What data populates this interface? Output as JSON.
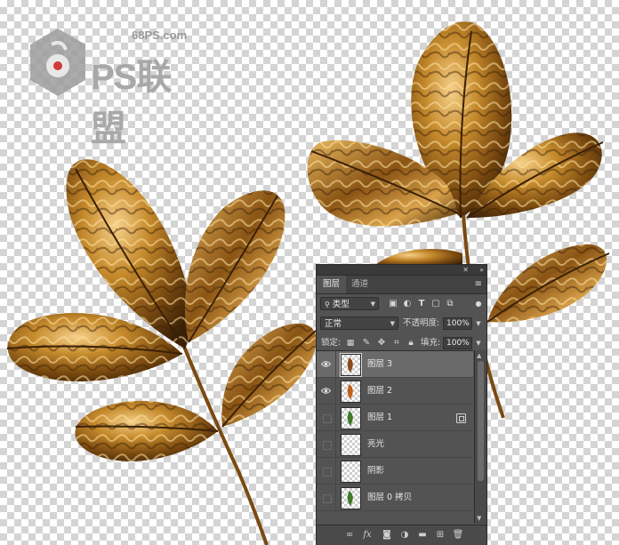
{
  "watermark": {
    "domain": "68PS.com",
    "title": "PS联盟"
  },
  "panel": {
    "tabs": [
      {
        "label": "图层",
        "active": true
      },
      {
        "label": "通道",
        "active": false
      }
    ],
    "filter": {
      "kind_label": "类型",
      "icons": [
        "image-filter-icon",
        "adjustment-filter-icon",
        "type-filter-icon",
        "shape-filter-icon",
        "smart-object-filter-icon"
      ]
    },
    "blend_mode": "正常",
    "opacity_label": "不透明度:",
    "opacity_value": "100%",
    "lock_label": "锁定:",
    "fill_label": "填充:",
    "fill_value": "100%",
    "layers": [
      {
        "name": "图层 3",
        "visible": true,
        "selected": true,
        "thumb": "leaf-brown"
      },
      {
        "name": "图层 2",
        "visible": true,
        "selected": false,
        "thumb": "leaf-orange"
      },
      {
        "name": "图层 1",
        "visible": false,
        "selected": false,
        "thumb": "leaf-green",
        "badge": "smart-object"
      },
      {
        "name": "亮光",
        "visible": false,
        "selected": false,
        "thumb": "transparent"
      },
      {
        "name": "阴影",
        "visible": false,
        "selected": false,
        "thumb": "transparent"
      },
      {
        "name": "图层 0 拷贝",
        "visible": false,
        "selected": false,
        "thumb": "leaf-green"
      }
    ],
    "bottom_icons": [
      "link-layers-icon",
      "fx-icon",
      "mask-icon",
      "adjustment-icon",
      "group-icon",
      "new-layer-icon",
      "trash-icon"
    ]
  },
  "colors": {
    "gold_dark": "#4a2a08",
    "gold_mid": "#a8701e",
    "gold_light": "#f0c878",
    "panel_bg": "#535353"
  }
}
